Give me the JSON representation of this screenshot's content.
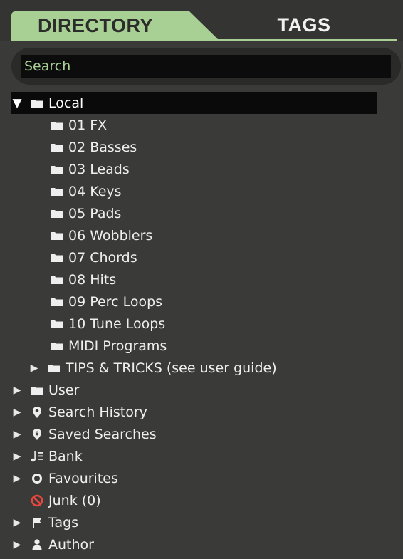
{
  "tabs": {
    "directory_label": "DIRECTORY",
    "tags_label": "TAGS"
  },
  "search": {
    "placeholder": "Search",
    "value": ""
  },
  "colors": {
    "accent": "#a8d094",
    "panel_bg": "#3a3a38",
    "selected_row": "#0a0a0a",
    "junk_icon": "#e8473f"
  },
  "tree": {
    "local": {
      "label": "Local",
      "expanded": true,
      "icon": "folder-icon"
    },
    "local_children": [
      {
        "label": "01 FX",
        "icon": "folder-icon"
      },
      {
        "label": "02 Basses",
        "icon": "folder-icon"
      },
      {
        "label": "03 Leads",
        "icon": "folder-icon"
      },
      {
        "label": "04 Keys",
        "icon": "folder-icon"
      },
      {
        "label": "05 Pads",
        "icon": "folder-icon"
      },
      {
        "label": "06 Wobblers",
        "icon": "folder-icon"
      },
      {
        "label": "07 Chords",
        "icon": "folder-icon"
      },
      {
        "label": "08 Hits",
        "icon": "folder-icon"
      },
      {
        "label": "09 Perc Loops",
        "icon": "folder-icon"
      },
      {
        "label": "10 Tune Loops",
        "icon": "folder-icon"
      },
      {
        "label": "MIDI Programs",
        "icon": "folder-icon"
      },
      {
        "label": "TIPS & TRICKS (see user guide)",
        "icon": "folder-icon",
        "collapsed": true
      }
    ],
    "roots": [
      {
        "label": "User",
        "icon": "folder-icon"
      },
      {
        "label": "Search History",
        "icon": "location-pin-icon"
      },
      {
        "label": "Saved Searches",
        "icon": "saved-search-pin-icon"
      },
      {
        "label": "Bank",
        "icon": "bank-note-icon"
      },
      {
        "label": "Favourites",
        "icon": "favourites-circle-icon"
      },
      {
        "label": "Junk (0)",
        "icon": "no-entry-icon"
      },
      {
        "label": "Tags",
        "icon": "flag-icon"
      },
      {
        "label": "Author",
        "icon": "person-icon"
      }
    ]
  }
}
